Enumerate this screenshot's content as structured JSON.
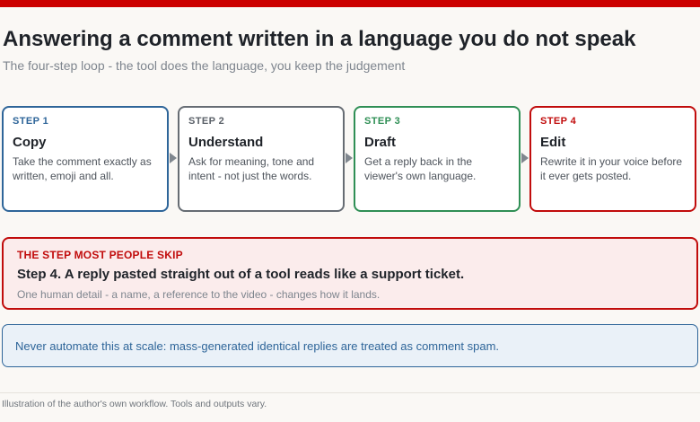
{
  "header": {
    "title": "Answering a comment written in a language you do not speak",
    "subtitle": "The four-step loop - the tool does the language, you keep the judgement"
  },
  "steps": [
    {
      "label": "STEP 1",
      "title": "Copy",
      "desc": "Take the comment exactly as written, emoji and all.",
      "color": "#2e6599"
    },
    {
      "label": "STEP 2",
      "title": "Understand",
      "desc": "Ask for meaning, tone and intent - not just the words.",
      "color": "#666c73"
    },
    {
      "label": "STEP 3",
      "title": "Draft",
      "desc": "Get a reply back in the viewer's own language.",
      "color": "#2f8f55"
    },
    {
      "label": "STEP 4",
      "title": "Edit",
      "desc": "Rewrite it in your voice before it ever gets posted.",
      "color": "#c10c0c"
    }
  ],
  "callout": {
    "eyebrow": "THE STEP MOST PEOPLE SKIP",
    "headline": "Step 4. A reply pasted straight out of a tool reads like a support ticket.",
    "subtext": "One human detail - a name, a reference to the video - changes how it lands."
  },
  "note": {
    "text": "Never automate this at scale: mass-generated identical replies are treated as comment spam."
  },
  "footer": {
    "text": "Illustration of the author's own workflow. Tools and outputs vary."
  },
  "colors": {
    "accent_red": "#cc0000",
    "step_blue": "#2e6599",
    "step_gray": "#666c73",
    "step_green": "#2f8f55",
    "step_red": "#c10c0c",
    "background": "#faf8f5"
  }
}
